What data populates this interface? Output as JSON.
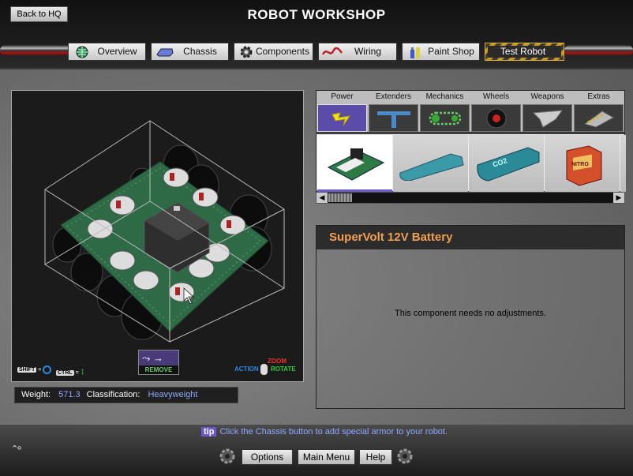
{
  "header": {
    "back_label": "Back to HQ",
    "title": "ROBOT WORKSHOP"
  },
  "tabs": [
    {
      "label": "Overview",
      "icon": "globe-icon",
      "active": false
    },
    {
      "label": "Chassis",
      "icon": "chassis-icon",
      "active": false
    },
    {
      "label": "Components",
      "icon": "gear-icon",
      "active": false
    },
    {
      "label": "Wiring",
      "icon": "wire-icon",
      "active": false
    },
    {
      "label": "Paint Shop",
      "icon": "paint-icon",
      "active": false
    },
    {
      "label": "Test Robot",
      "icon": "",
      "active": true
    }
  ],
  "viewport": {
    "remove_label": "REMOVE",
    "shift_key": "SHIFT",
    "ctrl_key": "CTRL",
    "action_label": "ACTION",
    "zoom_label": "ZOOM",
    "rotate_label": "ROTATE"
  },
  "stats": {
    "weight_label": "Weight:",
    "weight_value": "571.3",
    "class_label": "Classification:",
    "class_value": "Heavyweight"
  },
  "categories": [
    {
      "label": "Power",
      "icon": "lightning-icon",
      "selected": true
    },
    {
      "label": "Extenders",
      "icon": "extender-icon",
      "selected": false
    },
    {
      "label": "Mechanics",
      "icon": "chain-icon",
      "selected": false
    },
    {
      "label": "Wheels",
      "icon": "wheel-icon",
      "selected": false
    },
    {
      "label": "Weapons",
      "icon": "blade-icon",
      "selected": false
    },
    {
      "label": "Extras",
      "icon": "plow-icon",
      "selected": false
    }
  ],
  "items": [
    {
      "name": "circuit-board",
      "selected": true
    },
    {
      "name": "blue-tank",
      "selected": false
    },
    {
      "name": "co2-tank",
      "selected": false
    },
    {
      "name": "fuel-canister",
      "selected": false
    }
  ],
  "item_labels": {
    "co2": "CO2",
    "canister": "NITRO"
  },
  "detail": {
    "title": "SuperVolt 12V Battery",
    "message": "This component needs no adjustments."
  },
  "footer": {
    "tip_badge": "tip",
    "tip_text": "Click the Chassis button to add special armor to your robot.",
    "options_label": "Options",
    "main_menu_label": "Main Menu",
    "help_label": "Help"
  },
  "colors": {
    "accent": "#6a5acd",
    "highlight_text": "#8ea8ff",
    "detail_title": "#f0a050"
  }
}
